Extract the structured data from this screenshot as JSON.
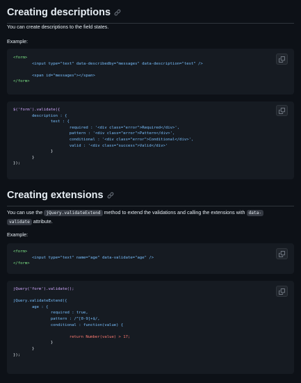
{
  "section1": {
    "title": "Creating descriptions",
    "intro": "You can create descriptions to the field states.",
    "example_label": "Example:",
    "code_html": [
      "<form>",
      "        <input type=\"text\" data-describedby=\"messages\" data-description=\"test\" />",
      "",
      "        <span id=\"messages\"></span>",
      "</form>"
    ],
    "code_js": [
      "$('form').validate({",
      "        description : {",
      "                test : {",
      "                        required : '<div class=\"error\">Required</div>',",
      "                        pattern : '<div class=\"error\">Pattern</div>',",
      "                        conditional : '<div class=\"error\">Conditional</div>',",
      "                        valid : '<div class=\"success\">Valid</div>'",
      "                }",
      "        }",
      "});"
    ]
  },
  "section2": {
    "title": "Creating extensions",
    "intro_before": "You can use the ",
    "intro_code1": "jQuery.validateExtend",
    "intro_middle": " method to extend the validations and calling the extensions with ",
    "intro_code2_a": "data-",
    "intro_code2_b": "validate",
    "intro_after": " attribute.",
    "example_label": "Example:",
    "code_html": [
      "<form>",
      "        <input type=\"text\" name=\"age\" data-validate=\"age\" />",
      "</form>"
    ],
    "code_js": [
      "jQuery('form').validate();",
      "",
      "jQuery.validateExtend({",
      "        age : {",
      "                required : true,",
      "                pattern : /^[0-9]+$/,",
      "                conditional : function(value) {",
      "",
      "                        return Number(value) > 17;",
      "                }",
      "        }",
      "});"
    ]
  },
  "icons": {
    "anchor": "link-icon",
    "copy": "copy-icon"
  },
  "colors": {
    "background": "#0d1117",
    "code_background": "#161b22",
    "tag": "#7ee787",
    "attribute": "#79c0ff",
    "string": "#a5d6ff",
    "keyword": "#ff7b72",
    "function": "#d2a8ff"
  }
}
